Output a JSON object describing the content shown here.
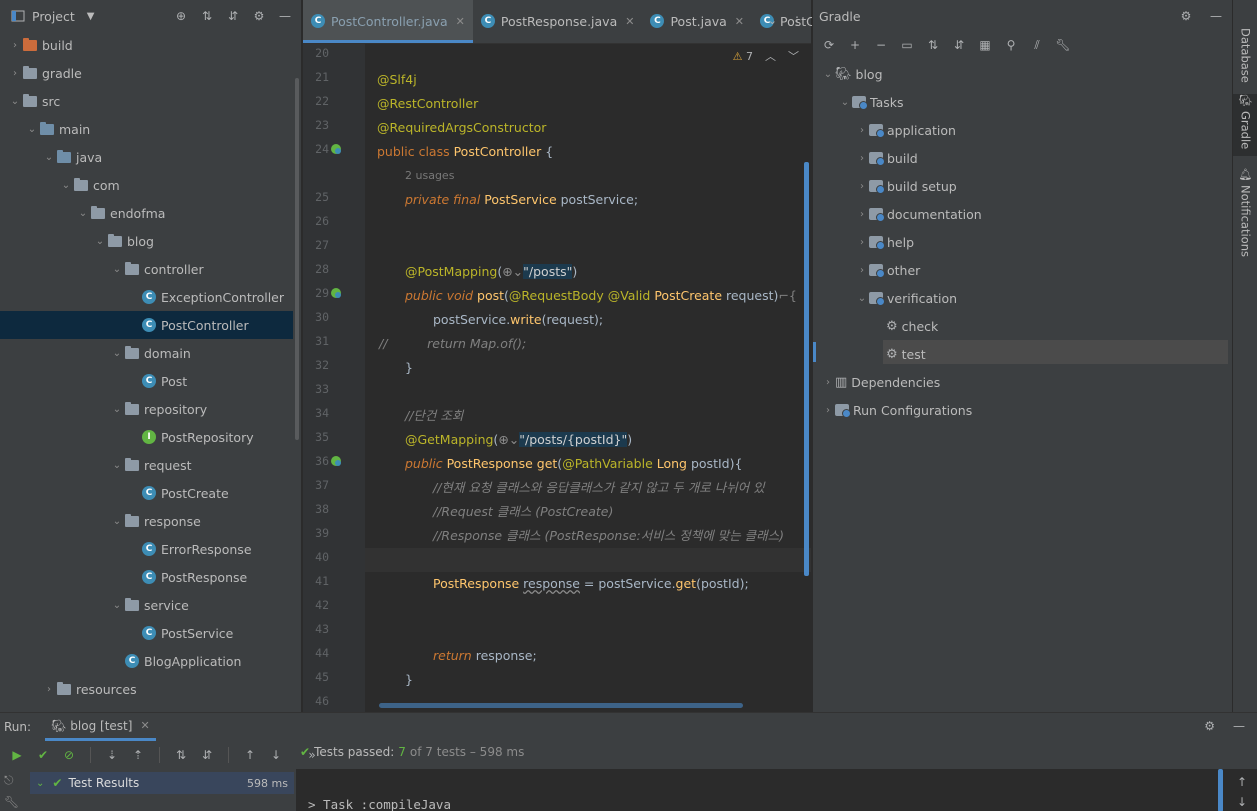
{
  "project": {
    "title": "Project",
    "tree": [
      {
        "label": "build",
        "kind": "folder-build",
        "level": 0,
        "arrow": "›"
      },
      {
        "label": "gradle",
        "kind": "folder",
        "level": 0,
        "arrow": "›"
      },
      {
        "label": "src",
        "kind": "folder",
        "level": 0,
        "arrow": "⌄"
      },
      {
        "label": "main",
        "kind": "folder-src",
        "level": 1,
        "arrow": "⌄"
      },
      {
        "label": "java",
        "kind": "folder-src",
        "level": 2,
        "arrow": "⌄"
      },
      {
        "label": "com",
        "kind": "folder",
        "level": 3,
        "arrow": "⌄"
      },
      {
        "label": "endofma",
        "kind": "folder",
        "level": 4,
        "arrow": "⌄"
      },
      {
        "label": "blog",
        "kind": "folder",
        "level": 5,
        "arrow": "⌄"
      },
      {
        "label": "controller",
        "kind": "folder",
        "level": 6,
        "arrow": "⌄"
      },
      {
        "label": "ExceptionController",
        "kind": "class",
        "level": 7,
        "arrow": ""
      },
      {
        "label": "PostController",
        "kind": "class",
        "level": 7,
        "arrow": "",
        "selected": true
      },
      {
        "label": "domain",
        "kind": "folder",
        "level": 6,
        "arrow": "⌄"
      },
      {
        "label": "Post",
        "kind": "class",
        "level": 7,
        "arrow": ""
      },
      {
        "label": "repository",
        "kind": "folder",
        "level": 6,
        "arrow": "⌄"
      },
      {
        "label": "PostRepository",
        "kind": "interface",
        "level": 7,
        "arrow": ""
      },
      {
        "label": "request",
        "kind": "folder",
        "level": 6,
        "arrow": "⌄"
      },
      {
        "label": "PostCreate",
        "kind": "class",
        "level": 7,
        "arrow": ""
      },
      {
        "label": "response",
        "kind": "folder",
        "level": 6,
        "arrow": "⌄"
      },
      {
        "label": "ErrorResponse",
        "kind": "class",
        "level": 7,
        "arrow": ""
      },
      {
        "label": "PostResponse",
        "kind": "class",
        "level": 7,
        "arrow": ""
      },
      {
        "label": "service",
        "kind": "folder",
        "level": 6,
        "arrow": "⌄"
      },
      {
        "label": "PostService",
        "kind": "class",
        "level": 7,
        "arrow": ""
      },
      {
        "label": "BlogApplication",
        "kind": "spring",
        "level": 6,
        "arrow": ""
      },
      {
        "label": "resources",
        "kind": "folder-res",
        "level": 2,
        "arrow": "›"
      }
    ]
  },
  "editor": {
    "tabs": [
      {
        "label": "PostController.java",
        "active": true
      },
      {
        "label": "PostResponse.java",
        "active": false
      },
      {
        "label": "Post.java",
        "active": false
      },
      {
        "label": "PostC",
        "active": false
      }
    ],
    "warnings_count": "7",
    "line_numbers": [
      "20",
      "21",
      "22",
      "23",
      "24",
      "",
      "25",
      "26",
      "27",
      "28",
      "29",
      "30",
      "31",
      "32",
      "33",
      "34",
      "35",
      "36",
      "37",
      "38",
      "39",
      "40",
      "41",
      "42",
      "43",
      "44",
      "45",
      "46"
    ],
    "usages_hint": "2 usages"
  },
  "gradle": {
    "title": "Gradle",
    "root": "blog",
    "tasks_label": "Tasks",
    "task_groups": [
      "application",
      "build",
      "build setup",
      "documentation",
      "help",
      "other",
      "verification"
    ],
    "verification_tasks": [
      "check",
      "test"
    ],
    "dependencies_label": "Dependencies",
    "run_configs_label": "Run Configurations"
  },
  "sidebar": {
    "tabs": [
      "Database",
      "Gradle",
      "Notifications"
    ]
  },
  "run": {
    "label": "Run:",
    "tab_label": "blog [test]",
    "status_prefix": "Tests passed:",
    "passed": "7",
    "status_of": "of 7 tests – 598 ms",
    "results_label": "Test Results",
    "results_time": "598 ms",
    "console_line": "> Task :compileJava"
  },
  "colors": {
    "accent": "#4a88c7",
    "pass": "#62b543",
    "keyword": "#cc7832",
    "annotation": "#bbb529",
    "string": "#6a8759"
  }
}
